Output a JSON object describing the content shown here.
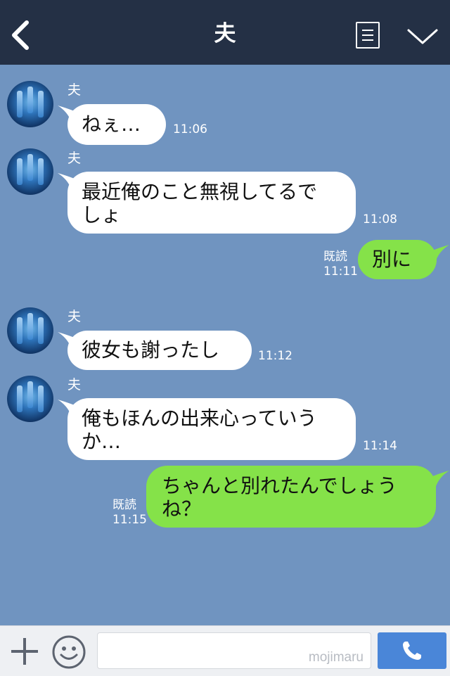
{
  "header": {
    "title": "夫",
    "icons": [
      "chevron-left-icon",
      "menu-icon",
      "chevron-down-icon"
    ]
  },
  "messages": [
    {
      "direction": "in",
      "sender": "夫",
      "text": "ねぇ…",
      "time": "11:06"
    },
    {
      "direction": "in",
      "sender": "夫",
      "text": "最近俺のこと無視してるで\nしょ",
      "time": "11:08"
    },
    {
      "direction": "out",
      "read": "既読",
      "text": "別に",
      "time": "11:11"
    },
    {
      "direction": "in",
      "sender": "夫",
      "text": "彼女も謝ったし",
      "time": "11:12"
    },
    {
      "direction": "in",
      "sender": "夫",
      "text": "俺もほんの出来心っていう\nか…",
      "time": "11:14"
    },
    {
      "direction": "out",
      "read": "既読",
      "text": "ちゃんと別れたんでしょう\nね？",
      "time": "11:15"
    }
  ],
  "footer": {
    "watermark": "mojimaru",
    "icons": [
      "plus-icon",
      "emoji-icon",
      "phone-icon"
    ]
  },
  "colors": {
    "header_bg": "#243045",
    "chat_bg": "#7094c0",
    "incoming_bubble": "#ffffff",
    "outgoing_bubble": "#85e249",
    "send_button": "#4a86d8"
  }
}
